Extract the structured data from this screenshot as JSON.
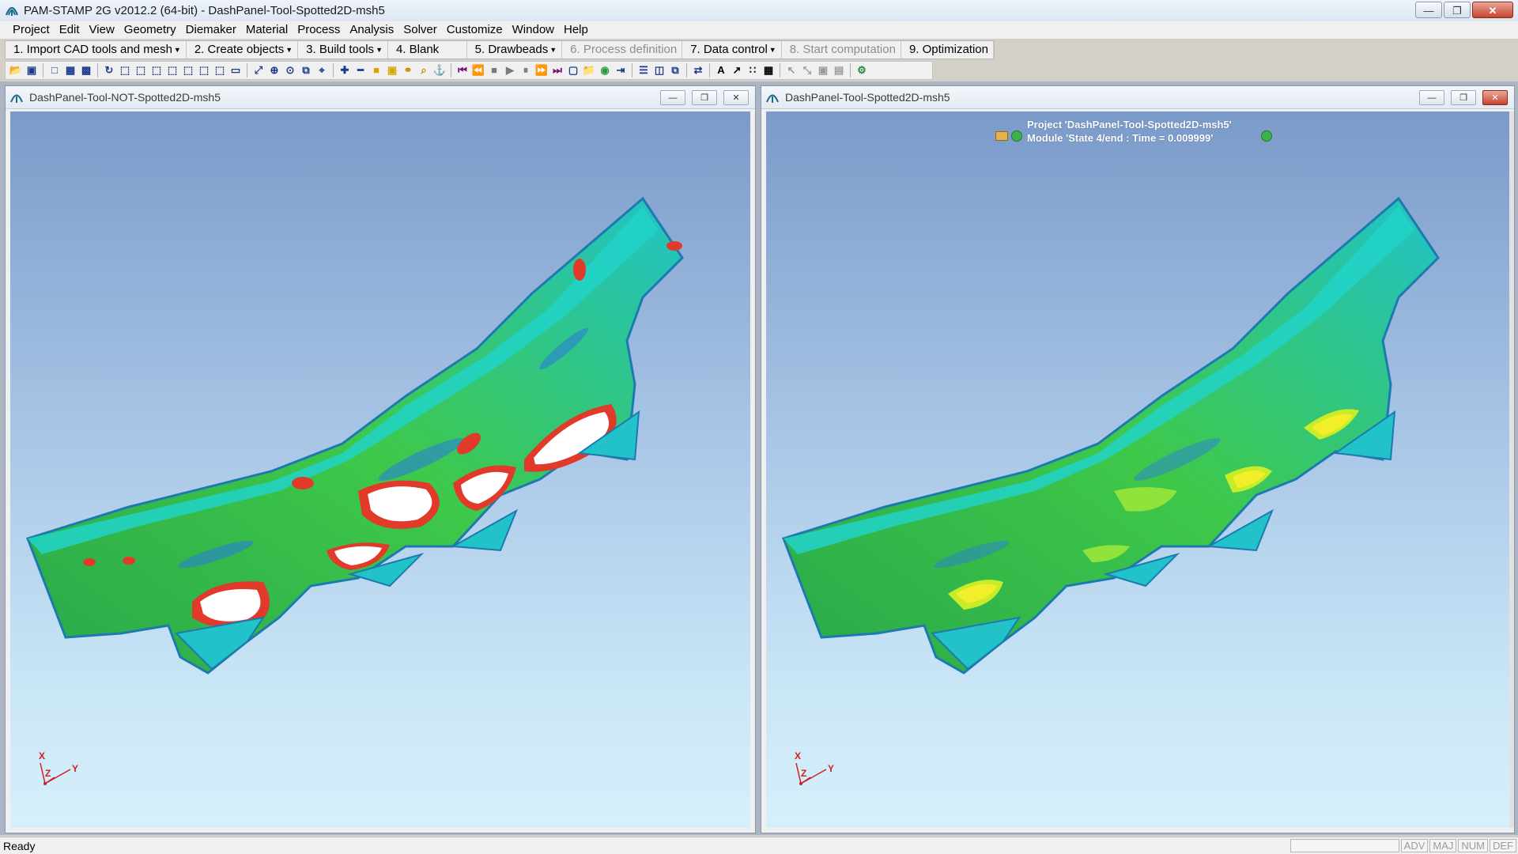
{
  "window": {
    "title": "PAM-STAMP 2G v2012.2 (64-bit) - DashPanel-Tool-Spotted2D-msh5",
    "minimize_icon": "minimize-icon",
    "restore_icon": "restore-icon",
    "close_icon": "close-icon"
  },
  "menu": [
    "Project",
    "Edit",
    "View",
    "Geometry",
    "Diemaker",
    "Material",
    "Process",
    "Analysis",
    "Solver",
    "Customize",
    "Window",
    "Help"
  ],
  "process_toolbar": [
    {
      "label": "1. Import CAD tools and mesh",
      "dropdown": true,
      "enabled": true
    },
    {
      "label": "2. Create objects",
      "dropdown": true,
      "enabled": true
    },
    {
      "label": "3. Build tools",
      "dropdown": true,
      "enabled": true
    },
    {
      "label": "4. Blank",
      "dropdown": false,
      "enabled": true
    },
    {
      "label": "5. Drawbeads",
      "dropdown": true,
      "enabled": true
    },
    {
      "label": "6. Process definition",
      "dropdown": false,
      "enabled": false
    },
    {
      "label": "7. Data control",
      "dropdown": true,
      "enabled": true
    },
    {
      "label": "8. Start computation",
      "dropdown": false,
      "enabled": false
    },
    {
      "label": "9. Optimization",
      "dropdown": false,
      "enabled": true
    }
  ],
  "left_view": {
    "title": "DashPanel-Tool-NOT-Spotted2D-msh5"
  },
  "right_view": {
    "title": "DashPanel-Tool-Spotted2D-msh5",
    "info_line1": "Project 'DashPanel-Tool-Spotted2D-msh5'",
    "info_line2": "Module 'State 4/end : Time = 0.009999'"
  },
  "axes": {
    "x": "X",
    "y": "Y",
    "z": "Z"
  },
  "status": {
    "text": "Ready",
    "indicators": [
      "ADV",
      "MAJ",
      "NUM",
      "DEF"
    ]
  },
  "colors": {
    "contour_green": "#3ec84a",
    "contour_cyan": "#21d3c8",
    "contour_blue": "#2a7fd6",
    "contour_red": "#e23a2a",
    "contour_yellow": "#f2ee2a",
    "viewport_top": "#7a9ac9",
    "viewport_bottom": "#d6f0fb"
  }
}
